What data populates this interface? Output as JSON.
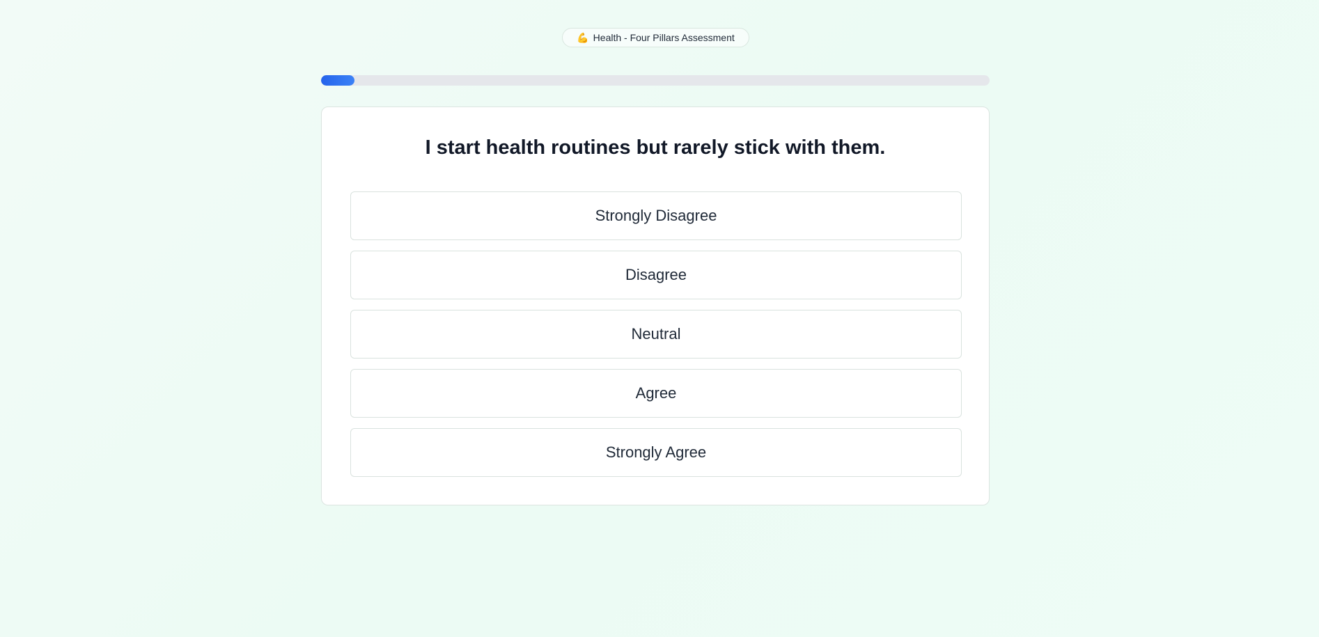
{
  "header": {
    "badge_icon": "💪",
    "badge_icon_name": "flexed-biceps-icon",
    "badge_label": "Health - Four Pillars Assessment"
  },
  "progress": {
    "fraction": 0.05,
    "color": "#2563eb"
  },
  "question": {
    "text": "I start health routines but rarely stick with them."
  },
  "options": [
    {
      "label": "Strongly Disagree"
    },
    {
      "label": "Disagree"
    },
    {
      "label": "Neutral"
    },
    {
      "label": "Agree"
    },
    {
      "label": "Strongly Agree"
    }
  ]
}
